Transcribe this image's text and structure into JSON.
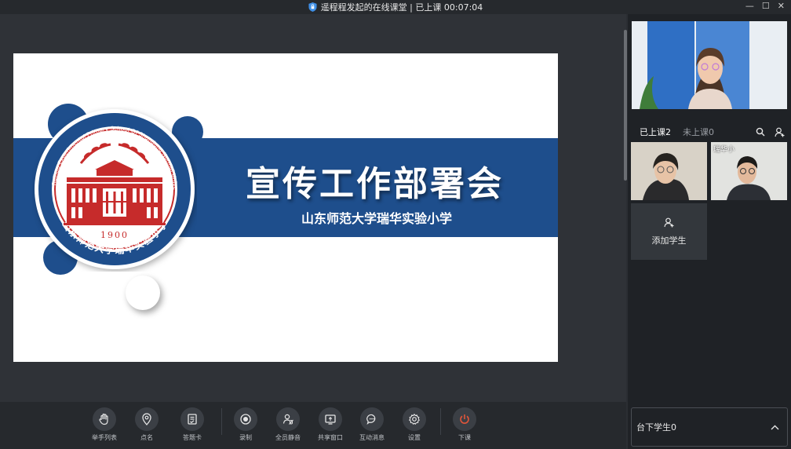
{
  "window": {
    "title": "遥程程发起的在线课堂 | 已上课 00:07:04"
  },
  "slide": {
    "title": "宣传工作部署会",
    "subtitle": "山东师范大学瑞华实验小学",
    "logo": {
      "ring_text": "Ruihua Experimental Primary School Of Shandong Normal University",
      "name_cn": "山东师范大学瑞华实验小学",
      "year": "1900"
    }
  },
  "sidebar": {
    "tabs": [
      {
        "label": "已上课2",
        "active": true
      },
      {
        "label": "未上课0",
        "active": false
      }
    ],
    "students": [
      {
        "name": ""
      },
      {
        "name": "瑞华小"
      }
    ],
    "add_student_label": "添加学生",
    "underdesk_label": "台下学生0"
  },
  "toolbar": {
    "buttons": [
      {
        "label": "举手列表",
        "icon": "hand-icon"
      },
      {
        "label": "点名",
        "icon": "location-pin-icon"
      },
      {
        "label": "答题卡",
        "icon": "answer-card-icon"
      },
      {
        "label": "录制",
        "icon": "record-icon"
      },
      {
        "label": "全员静音",
        "icon": "mute-all-icon"
      },
      {
        "label": "共享窗口",
        "icon": "share-window-icon"
      },
      {
        "label": "互动消息",
        "icon": "chat-icon"
      },
      {
        "label": "设置",
        "icon": "gear-icon"
      },
      {
        "label": "下课",
        "icon": "power-icon"
      }
    ]
  },
  "colors": {
    "accent_blue": "#1e4e8c",
    "logo_red": "#c62b2b",
    "end_class": "#e0553a"
  }
}
